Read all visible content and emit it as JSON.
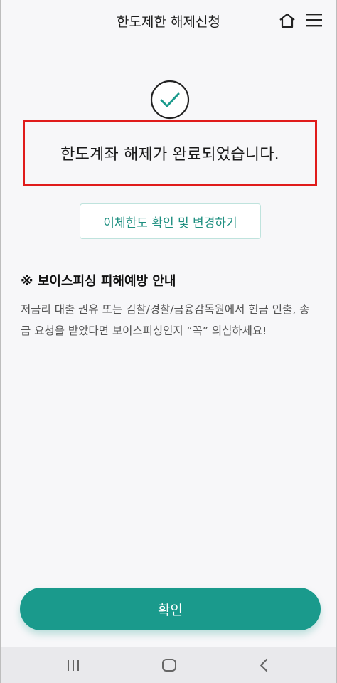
{
  "header": {
    "title": "한도제한 해제신청",
    "home_icon": "home-icon",
    "menu_icon": "hamburger-menu-icon"
  },
  "result": {
    "icon": "check-circle-icon",
    "message": "한도계좌 해제가 완료되었습니다."
  },
  "limit_button": {
    "label": "이체한도 확인 및 변경하기"
  },
  "notice": {
    "title": "※ 보이스피싱 피해예방 안내",
    "body": "저금리 대출 권유 또는 검찰/경찰/금융감독원에서 현금 인출, 송금 요청을 받았다면 보이스피싱인지 “꼭” 의심하세요!"
  },
  "confirm_button": {
    "label": "확인"
  },
  "system_nav": {
    "recent_icon": "recent-apps-icon",
    "home_icon": "nav-home-icon",
    "back_icon": "back-icon"
  },
  "colors": {
    "accent": "#1a9a8c",
    "highlight_border": "#e01b1b",
    "background": "#f7f7f9"
  }
}
